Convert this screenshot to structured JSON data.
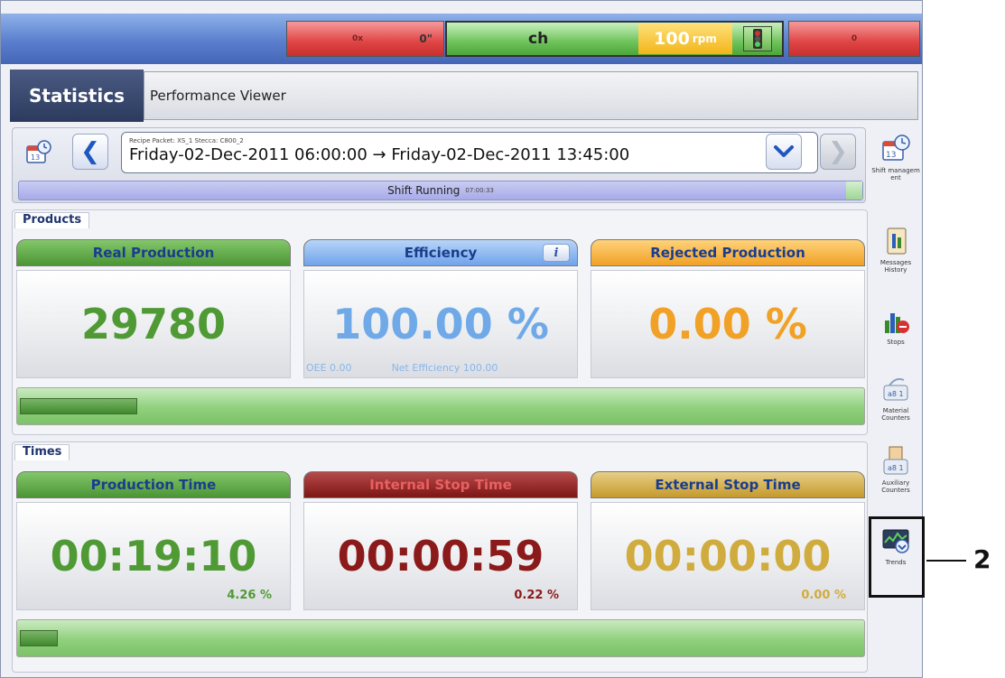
{
  "topbar": {
    "red_left_label": "0x",
    "red_left_value": "0\"",
    "product_code": "ch",
    "speed_value": "100",
    "speed_unit": "rpm",
    "red_right_label": "0"
  },
  "header": {
    "title": "Statistics",
    "tab": "Performance Viewer"
  },
  "nav": {
    "range_meta": "Recipe  Packet: XS_1  Stecca: C800_2",
    "range_text": "Friday-02-Dec-2011 06:00:00 → Friday-02-Dec-2011 13:45:00",
    "prev_glyph": "❮",
    "next_glyph": "❯",
    "dropdown_glyph": "⌵",
    "shift_status": "Shift Running",
    "shift_time": "07:00:33"
  },
  "products": {
    "label": "Products",
    "real": {
      "title": "Real Production",
      "value": "29780"
    },
    "efficiency": {
      "title": "Efficiency",
      "value": "100.00 %",
      "oee": "OEE 0.00",
      "net": "Net Efficiency 100.00",
      "info": "i"
    },
    "rejected": {
      "title": "Rejected Production",
      "value": "0.00 %"
    },
    "progress_fraction": 0.14
  },
  "times": {
    "label": "Times",
    "production": {
      "title": "Production Time",
      "value": "00:19:10",
      "pct": "4.26 %"
    },
    "internal": {
      "title": "Internal Stop Time",
      "value": "00:00:59",
      "pct": "0.22 %"
    },
    "external": {
      "title": "External Stop Time",
      "value": "00:00:00",
      "pct": "0.00 %"
    },
    "progress_fraction": 0.045
  },
  "sidebar": {
    "items": [
      {
        "label": "Shift managem ent"
      },
      {
        "label": "Messages History"
      },
      {
        "label": "Stops"
      },
      {
        "label": "Material Counters"
      },
      {
        "label": "Auxiliary Counters"
      },
      {
        "label": "Trends"
      }
    ]
  },
  "callout": {
    "number": "2"
  }
}
